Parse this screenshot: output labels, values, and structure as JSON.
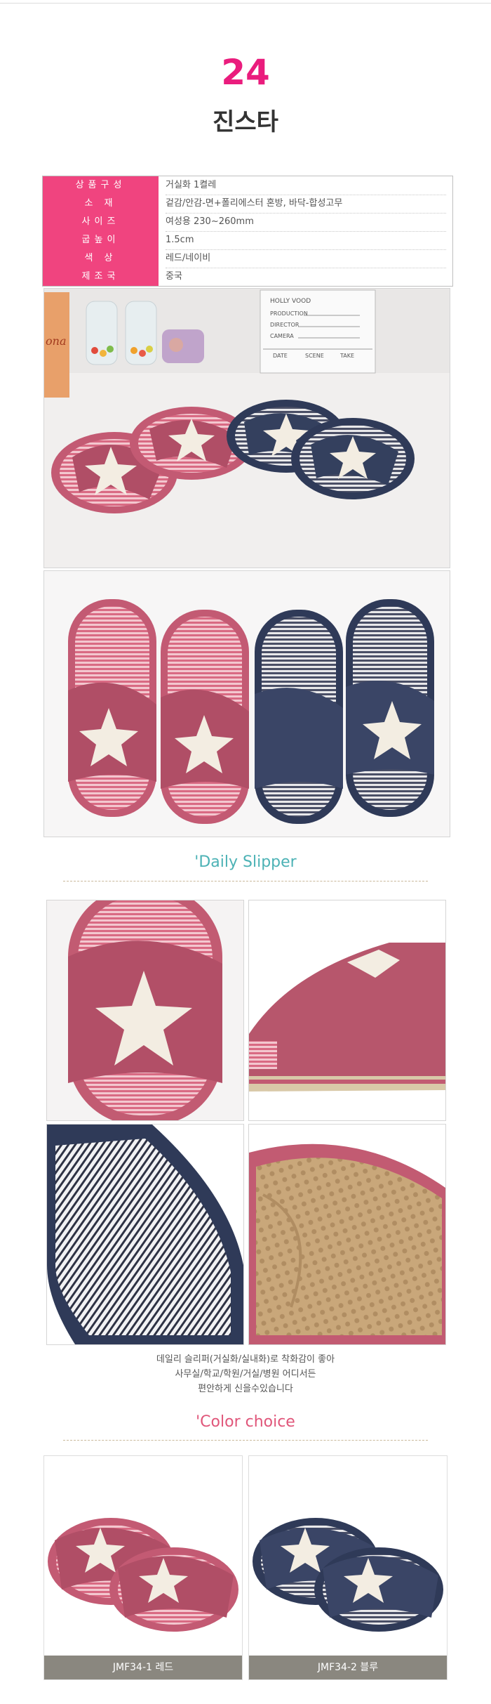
{
  "product": {
    "number": "24",
    "name": "진스타"
  },
  "spec": [
    {
      "label": "상품구성",
      "value": "거실화 1켤레"
    },
    {
      "label": "소 재",
      "value": "겉감/안감-면+폴리에스터 혼방, 바닥-합성고무"
    },
    {
      "label": "사이즈",
      "value": "여성용 230~260mm"
    },
    {
      "label": "굽높이",
      "value": "1.5cm"
    },
    {
      "label": "색 상",
      "value": "레드/네이비"
    },
    {
      "label": "제조국",
      "value": "중국"
    }
  ],
  "clapperboard": [
    "HOLLY VOOD",
    "PRODUCTION",
    "DIRECTOR",
    "CAMERA",
    "DATE",
    "SCENE",
    "TAKE"
  ],
  "jar_label": "ona",
  "sections": {
    "daily": "'Daily Slipper",
    "color": "'Color choice"
  },
  "caption": [
    "데일리 슬리퍼(거실화/실내화)로 착화감이 좋아",
    "사무실/학교/학원/거실/병원 어디서든",
    "편안하게 신을수있습니다"
  ],
  "colors": [
    {
      "code": "JMF34-1 레드",
      "swatch": "#b85567"
    },
    {
      "code": "JMF34-2 블루",
      "swatch": "#3a4866"
    }
  ],
  "theme": {
    "accent": "#ea1c7d",
    "spec_bg": "#f0447f",
    "daily": "#4cb2b5",
    "color_title": "#e0567a"
  }
}
